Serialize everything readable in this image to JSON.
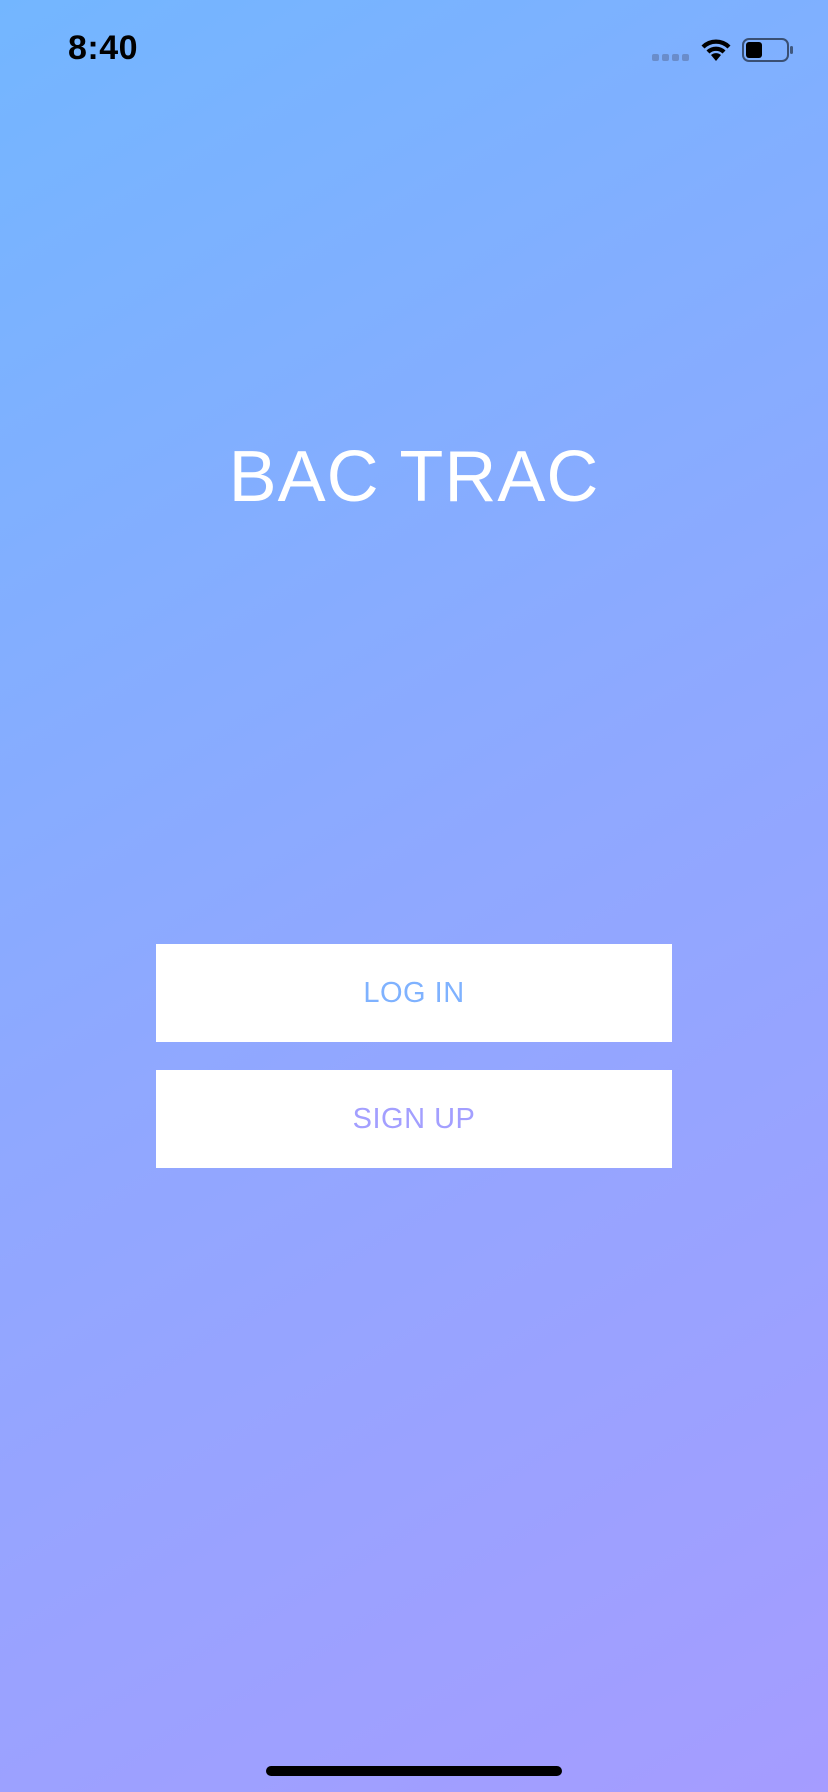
{
  "status_bar": {
    "time": "8:40",
    "icons": [
      "signal-icon",
      "wifi-icon",
      "battery-icon"
    ]
  },
  "app": {
    "title": "BAC TRAC"
  },
  "actions": {
    "login_label": "LOG IN",
    "signup_label": "SIGN UP"
  },
  "colors": {
    "gradient_start": "#73b6ff",
    "gradient_end": "#a59cff",
    "login_text": "#7fb2ff",
    "signup_text": "#a39fff",
    "button_bg": "#ffffff",
    "title_text": "#ffffff"
  }
}
